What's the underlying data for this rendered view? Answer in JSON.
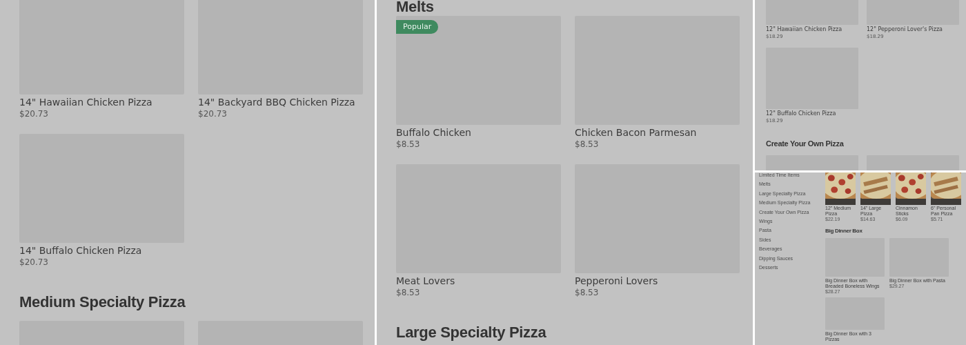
{
  "panels": [
    {
      "kind": "desktop",
      "sections": [
        {
          "items": [
            {
              "kind": "card",
              "name": "14\" Hawaiian Chicken Pizza",
              "price": "$20.73"
            },
            {
              "kind": "card",
              "name": "14\" Backyard BBQ Chicken Pizza",
              "price": "$20.73"
            },
            {
              "kind": "card",
              "name": "14\" Buffalo Chicken Pizza",
              "price": "$20.73"
            }
          ]
        },
        {
          "heading": "Medium Specialty Pizza",
          "items": [
            {
              "kind": "image_only"
            },
            {
              "kind": "image_only"
            }
          ]
        }
      ]
    },
    {
      "kind": "desktop",
      "sections": [
        {
          "heading": "Melts",
          "items": [
            {
              "kind": "card",
              "name": "Buffalo Chicken",
              "price": "$8.53",
              "badge": "Popular"
            },
            {
              "kind": "card",
              "name": "Chicken Bacon Parmesan",
              "price": "$8.53"
            },
            {
              "kind": "card",
              "name": "Meat Lovers",
              "price": "$8.53"
            },
            {
              "kind": "card",
              "name": "Pepperoni Lovers",
              "price": "$8.53"
            }
          ]
        },
        {
          "heading": "Large Specialty Pizza"
        }
      ]
    },
    {
      "kind": "compact",
      "sections": [
        {
          "items": [
            {
              "kind": "card",
              "name": "12\" Hawaiian Chicken Pizza",
              "price": "$18.29"
            },
            {
              "kind": "card",
              "name": "12\" Pepperoni Lover's Pizza",
              "price": "$18.29"
            },
            {
              "kind": "card",
              "name": "12\" Buffalo Chicken Pizza",
              "price": "$18.29"
            }
          ]
        },
        {
          "heading": "Create Your Own Pizza",
          "items": [
            {
              "kind": "image_only"
            },
            {
              "kind": "image_only"
            }
          ]
        }
      ]
    },
    {
      "kind": "sidebar",
      "sidebar": [
        "Limited Time Items",
        "Melts",
        "Large Specialty Pizza",
        "Medium Specialty Pizza",
        "Create Your Own Pizza",
        "Wings",
        "Pasta",
        "Sides",
        "Beverages",
        "Dipping Sauces",
        "Desserts"
      ],
      "sections": [
        {
          "items": [
            {
              "name": "12\" Medium Pizza",
              "price": "$22.19"
            },
            {
              "name": "14\" Large Pizza",
              "price": "$14.63"
            },
            {
              "name": "Cinnamon Sticks",
              "price": "$6.09"
            },
            {
              "name": "6\" Personal Pan Pizza",
              "price": "$5.71"
            }
          ]
        },
        {
          "heading": "Big Dinner Box",
          "items": [
            {
              "kind": "card",
              "name": "Big Dinner Box with Breaded Boneless Wings",
              "price": "$28.27"
            },
            {
              "kind": "card",
              "name": "Big Dinner Box with Pasta",
              "price": "$29.27"
            },
            {
              "kind": "card",
              "name": "Big Dinner Box with 3 Pizzas"
            }
          ]
        }
      ]
    }
  ]
}
